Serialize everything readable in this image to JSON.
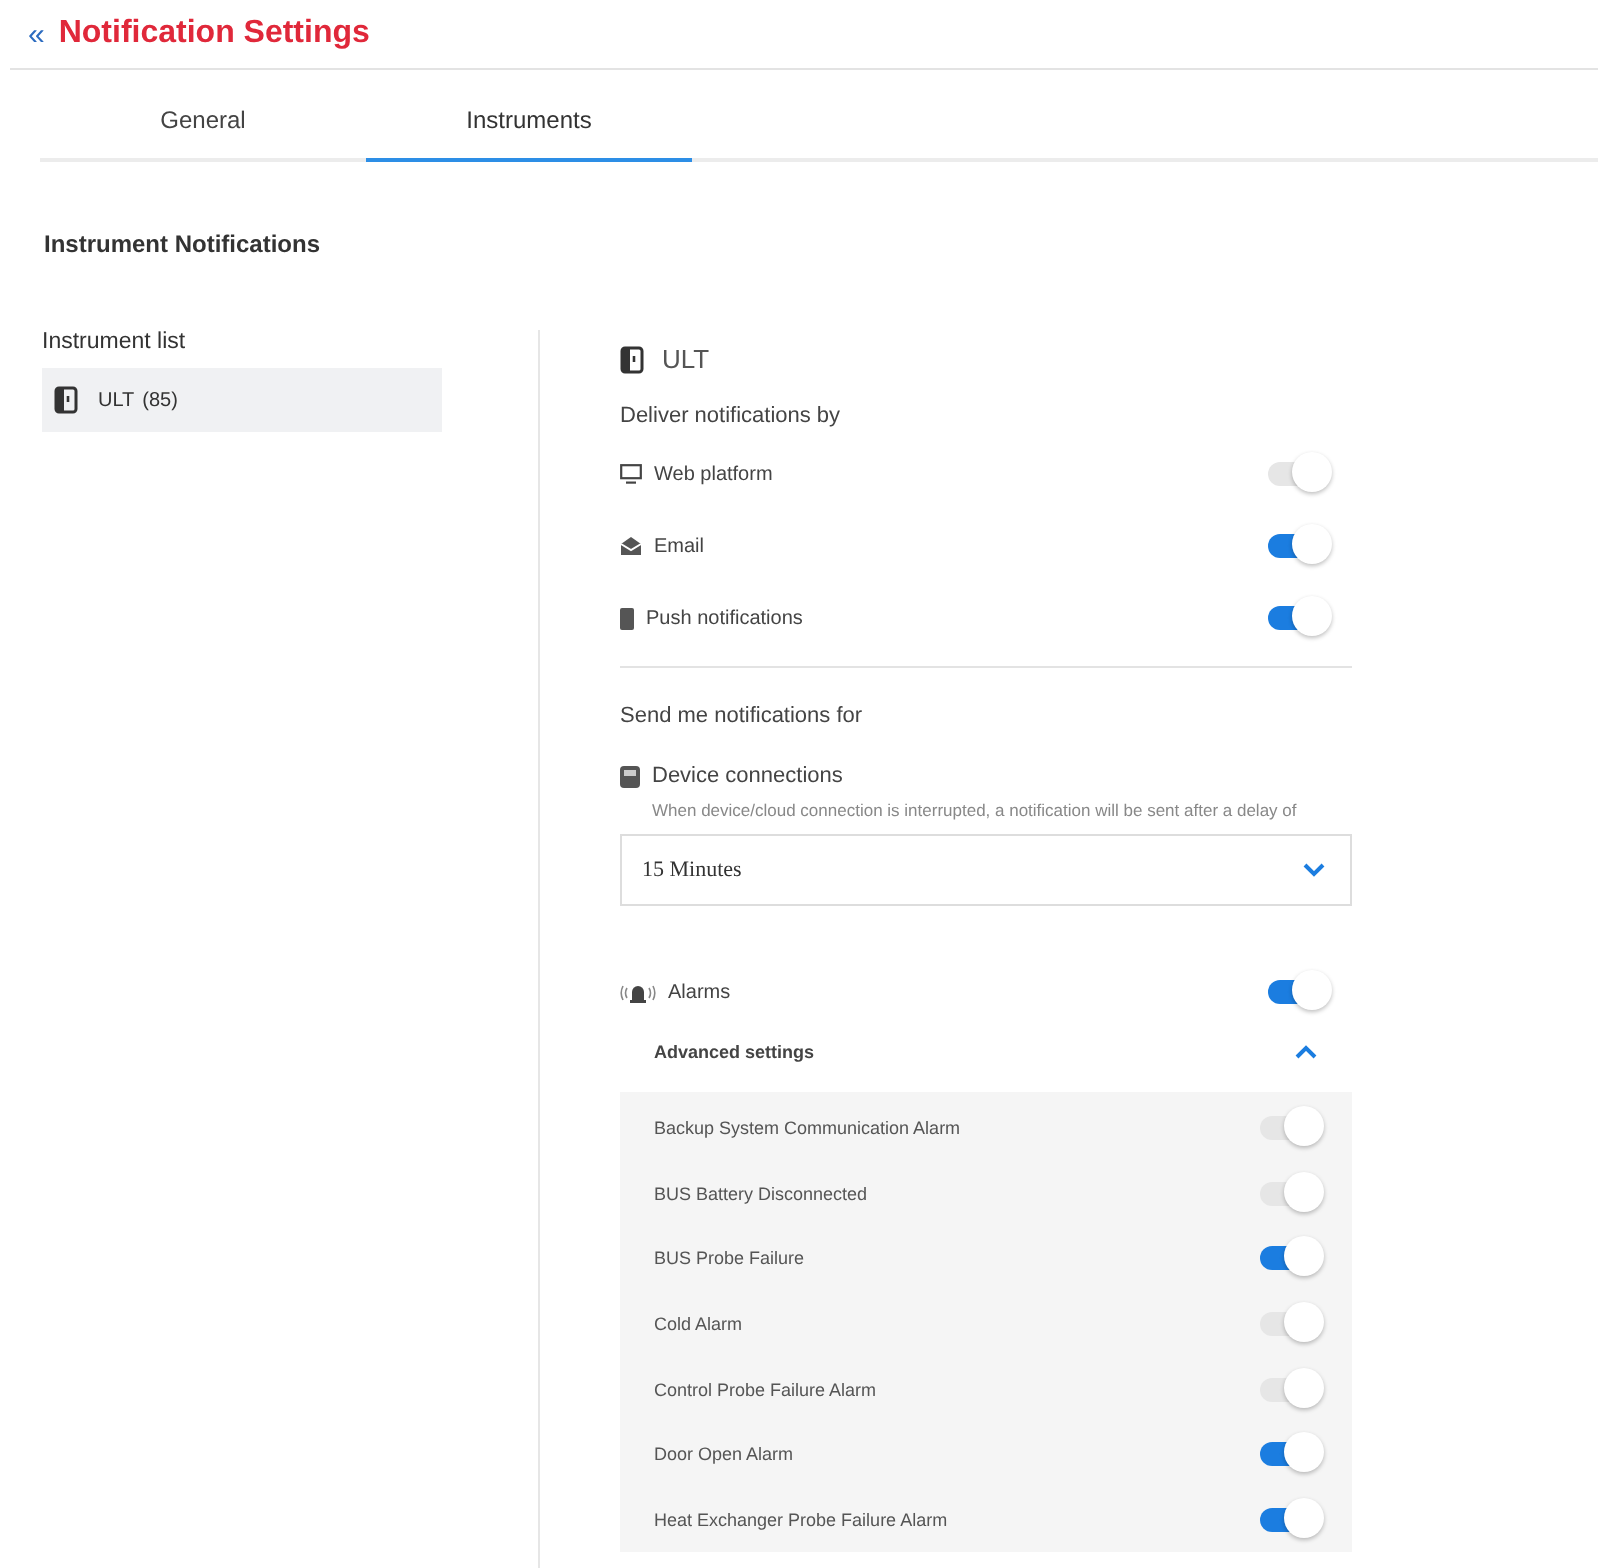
{
  "header": {
    "back": "«",
    "title": "Notification Settings"
  },
  "tabs": [
    {
      "label": "General",
      "selected": false
    },
    {
      "label": "Instruments",
      "selected": true
    }
  ],
  "section_title": "Instrument Notifications",
  "instrument_list": {
    "label": "Instrument list",
    "items": [
      {
        "name": "ULT",
        "count": "(85)",
        "selected": true
      }
    ]
  },
  "detail": {
    "title": "ULT",
    "deliver_label": "Deliver notifications by",
    "channels": [
      {
        "kind": "web",
        "label": "Web platform",
        "on": false
      },
      {
        "kind": "email",
        "label": "Email",
        "on": true
      },
      {
        "kind": "push",
        "label": "Push notifications",
        "on": true
      }
    ],
    "send_label": "Send me notifications for",
    "device_connections": {
      "label": "Device connections",
      "hint": "When device/cloud connection is interrupted, a notification will be sent after a delay of",
      "delay": "15 Minutes"
    },
    "alarms": {
      "label": "Alarms",
      "on": true,
      "advanced": {
        "label": "Advanced settings",
        "expanded": true,
        "items": [
          {
            "label": "Backup System Communication Alarm",
            "on": false
          },
          {
            "label": "BUS Battery Disconnected",
            "on": false
          },
          {
            "label": "BUS Probe Failure",
            "on": true
          },
          {
            "label": "Cold Alarm",
            "on": false
          },
          {
            "label": "Control Probe Failure Alarm",
            "on": false
          },
          {
            "label": "Door Open Alarm",
            "on": true
          },
          {
            "label": "Heat Exchanger Probe Failure Alarm",
            "on": true
          }
        ]
      }
    }
  }
}
